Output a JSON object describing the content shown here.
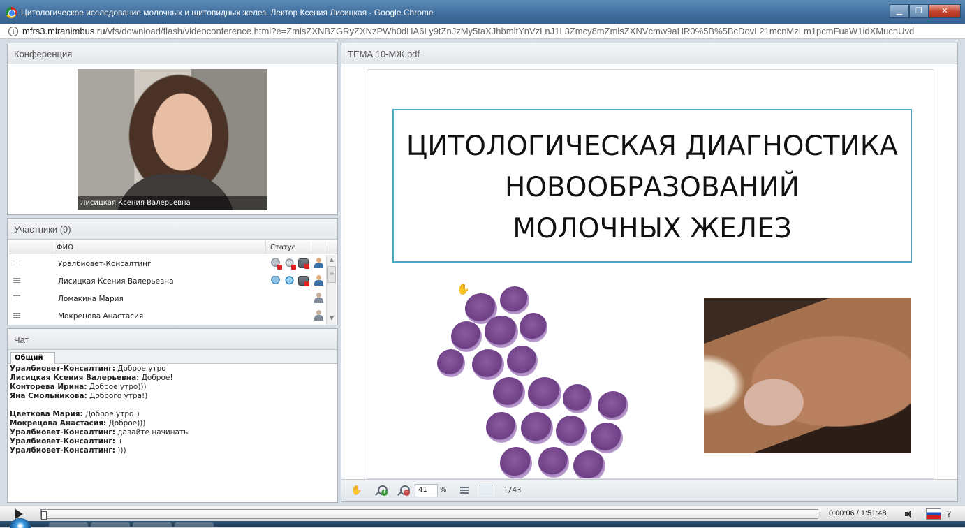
{
  "window": {
    "title": "Цитологическое исследование молочных и щитовидных желез. Лектор Ксения Лисицкая - Google Chrome",
    "minimize": "▁",
    "restore": "❐",
    "close": "✕"
  },
  "address": {
    "host": "mfrs3.miranimbus.ru",
    "path": "/vfs/download/flash/videoconference.html?e=ZmlsZXNBZGRyZXNzPWh0dHA6Ly9tZnJzMy5taXJhbmltYnVzLnJ1L3Zmcy8mZmlsZXNVcmw9aHR0%5B%5BcDovL21mcnMzLm1pcmFuaW1idXMucnUvd"
  },
  "conference": {
    "title": "Конференция",
    "speaker_name": "Лисицкая Ксения  Валерьевна"
  },
  "participants": {
    "title": "Участники (9)",
    "col_name": "ФИО",
    "col_status": "Статус",
    "rows": [
      {
        "name": "Уралбиовет-Консалтинг"
      },
      {
        "name": "Лисицкая Ксения  Валерьевна"
      },
      {
        "name": "Ломакина  Мария"
      },
      {
        "name": "Мокрецова Анастасия"
      }
    ]
  },
  "chat": {
    "title": "Чат",
    "tab": "Общий",
    "messages": [
      {
        "author": "Уралбиовет-Консалтинг:",
        "text": " Доброе утро"
      },
      {
        "author": "Лисицкая Ксения  Валерьевна:",
        "text": " Доброе!"
      },
      {
        "author": "Конторева Ирина:",
        "text": " Доброе утро)))"
      },
      {
        "author": "Яна  Смольникова:",
        "text": " Доброго утра!)"
      },
      {
        "author": "",
        "text": ""
      },
      {
        "author": "Цветкова  Мария:",
        "text": " Доброе утро!)"
      },
      {
        "author": "Мокрецова Анастасия:",
        "text": " Доброе)))"
      },
      {
        "author": "Уралбиовет-Консалтинг:",
        "text": " давайте начинать"
      },
      {
        "author": "Уралбиовет-Консалтинг:",
        "text": " +"
      },
      {
        "author": "Уралбиовет-Консалтинг:",
        "text": " )))"
      }
    ]
  },
  "presentation": {
    "title": "ТЕМА 10-МЖ.pdf",
    "slide_title_line1": "ЦИТОЛОГИЧЕСКАЯ ДИАГНОСТИКА",
    "slide_title_line2": "НОВООБРАЗОВАНИЙ",
    "slide_title_line3": "МОЛОЧНЫХ ЖЕЛЕЗ",
    "zoom_value": "41",
    "zoom_unit": "%",
    "page_indicator": "1/43"
  },
  "player": {
    "time": "0:00:06 / 1:51:48",
    "progress_fraction": 0.0009,
    "help": "?"
  },
  "colors": {
    "title_box_border": "#4aa8c6",
    "titlebar": "#3f6d9c"
  }
}
